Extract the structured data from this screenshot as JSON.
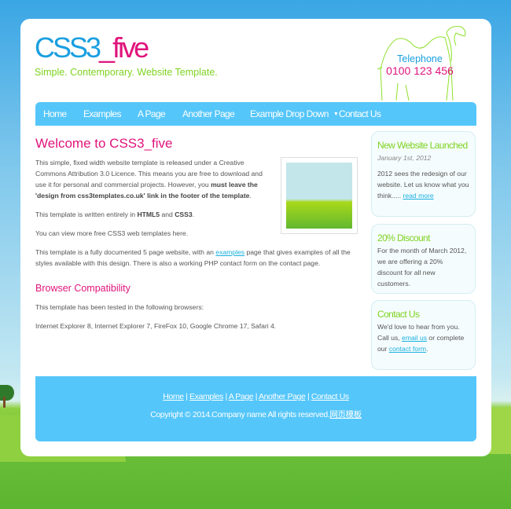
{
  "header": {
    "logo_part1": "CSS3",
    "logo_part2": "_five",
    "slogan": "Simple. Contemporary. Website Template.",
    "telephone_label": "Telephone",
    "telephone_number": "0100 123 456"
  },
  "nav": {
    "items": [
      "Home",
      "Examples",
      "A Page",
      "Another Page",
      "Example Drop Down",
      "Contact Us"
    ]
  },
  "main": {
    "title": "Welcome to CSS3_five",
    "p1_a": "This simple, fixed width website template is released under a Creative Commons Attribution 3.0 Licence. This means you are free to download and use it for personal and commercial projects. However, you ",
    "p1_bold": "must leave the 'design from css3templates.co.uk' link in the footer of the template",
    "p1_end": ".",
    "p2_a": "This template is written entirely in ",
    "p2_b1": "HTML5",
    "p2_and": " and ",
    "p2_b2": "CSS3",
    "p2_end": ".",
    "p3": "You can view more free CSS3 web templates here.",
    "p4_a": "This template is a fully documented 5 page website, with an ",
    "p4_link": "examples",
    "p4_b": " page that gives examples of all the styles available with this design. There is also a working PHP contact form on the contact page.",
    "h2": "Browser Compatibility",
    "p5": "This template has been tested in the following browsers:",
    "p6": "Internet Explorer 8, Internet Explorer 7, FireFox 10, Google Chrome 17, Safari 4."
  },
  "sidebar": [
    {
      "title": "New Website Launched",
      "date": "January 1st, 2012",
      "text": "2012 sees the redesign of our website. Let us know what you think..... ",
      "link": "read more"
    },
    {
      "title": "20% Discount",
      "text": "For the month of March 2012, we are offering a 20% discount for all new customers."
    },
    {
      "title": "Contact Us",
      "text_a": "We'd love to hear from you. Call us, ",
      "link1": "email us",
      "text_b": " or complete our ",
      "link2": "contact form",
      "text_c": "."
    }
  ],
  "footer": {
    "links": [
      "Home",
      "Examples",
      "A Page",
      "Another Page",
      "Contact Us"
    ],
    "sep": " | ",
    "copyright": "Copyright © 2014.Company name All rights reserved.",
    "copyright_link": "网页模板"
  },
  "colors": {
    "accent_blue": "#55c6fa",
    "pink": "#e0147c",
    "green": "#7ed321"
  }
}
